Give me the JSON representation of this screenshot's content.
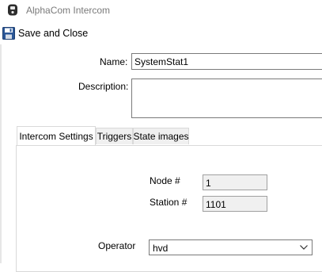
{
  "window": {
    "title": "AlphaCom Intercom",
    "icon": "alphacom-icon"
  },
  "toolbar": {
    "save_close_label": "Save and Close",
    "save_icon": "floppy-disk-icon"
  },
  "form": {
    "name_label": "Name:",
    "name_value": "SystemStat1",
    "description_label": "Description:",
    "description_value": ""
  },
  "tabs": [
    {
      "label": "Intercom Settings",
      "active": true
    },
    {
      "label": "Triggers",
      "active": false
    },
    {
      "label": "State images",
      "active": false
    }
  ],
  "intercom_settings": {
    "node_label": "Node #",
    "node_value": "1",
    "station_label": "Station #",
    "station_value": "1101",
    "operator_label": "Operator",
    "operator_value": "hvd"
  },
  "colors": {
    "border": "#7a7a7a",
    "tab_border": "#d9d9d9",
    "readonly_bg": "#f0f0f0",
    "title_text": "#7a7a7a",
    "save_icon": "#2b5797"
  }
}
